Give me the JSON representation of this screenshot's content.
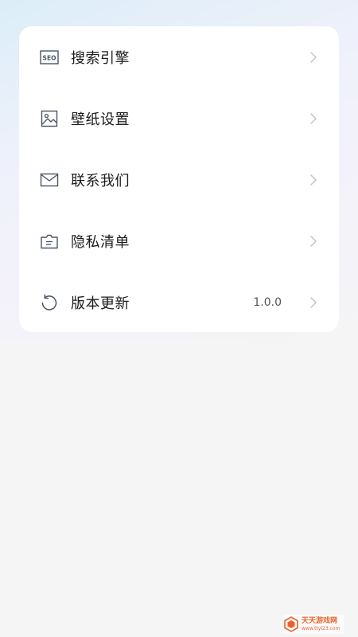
{
  "menu": {
    "items": [
      {
        "label": "搜索引擎",
        "icon": "seo-icon",
        "value": ""
      },
      {
        "label": "壁纸设置",
        "icon": "image-icon",
        "value": ""
      },
      {
        "label": "联系我们",
        "icon": "mail-icon",
        "value": ""
      },
      {
        "label": "隐私清单",
        "icon": "privacy-list-icon",
        "value": ""
      },
      {
        "label": "版本更新",
        "icon": "refresh-icon",
        "value": "1.0.0"
      }
    ]
  },
  "watermark": {
    "main": "天天游戏网",
    "sub": "www.ttyl23.com"
  },
  "colors": {
    "accent": "#4a5566",
    "watermark": "#e8632c"
  }
}
